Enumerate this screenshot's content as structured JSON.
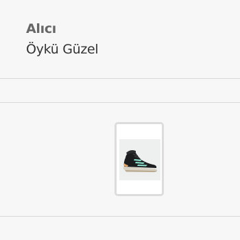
{
  "recipient": {
    "label": "Alıcı",
    "name": "Öykü Güzel"
  },
  "order_items": [
    {
      "image": "black-hiking-shoe-with-mint-stripes",
      "icon": "shoe-icon"
    }
  ],
  "colors": {
    "background": "#f7f7f7",
    "divider": "#d9d9d9",
    "thumb_border": "#dcdcdc",
    "label_text": "#666666",
    "name_text": "#333333"
  }
}
